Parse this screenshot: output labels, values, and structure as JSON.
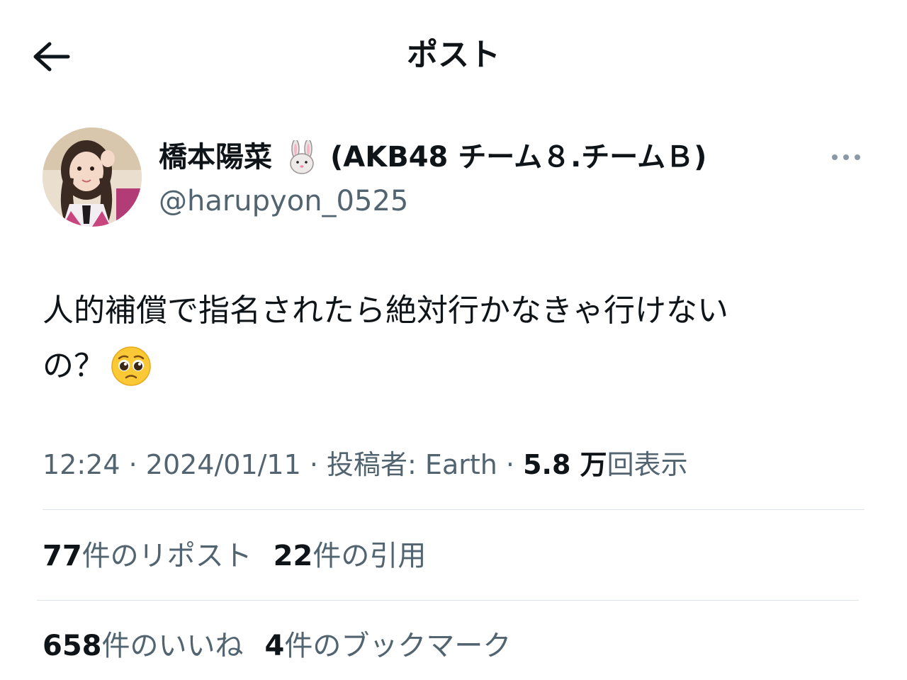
{
  "header": {
    "title": "ポスト",
    "back_icon": "arrow-left-icon"
  },
  "author": {
    "display_name": "橋本陽菜",
    "name_emoji": "rabbit-face-icon",
    "display_suffix": "(AKB48 チーム８.チームＢ)",
    "handle": "@harupyon_0525",
    "more_icon": "more-horizontal-icon"
  },
  "post": {
    "line1": "人的補償で指名されたら絶対行かなきゃ行けない",
    "line2": "の？",
    "trailing_emoji": "pleading-face-icon"
  },
  "meta": {
    "time": "12:24",
    "date": "2024/01/11",
    "posted_by_label": "投稿者: Earth",
    "views_number": "5.8 万",
    "views_label": "回表示",
    "separator": " · "
  },
  "stats": {
    "reposts_count": "77",
    "reposts_label": "件のリポスト",
    "quotes_count": "22",
    "quotes_label": "件の引用",
    "likes_count": "658",
    "likes_label": "件のいいね",
    "bookmarks_count": "4",
    "bookmarks_label": "件のブックマーク"
  },
  "colors": {
    "text_primary": "#0f1419",
    "text_secondary": "#536471",
    "divider": "#dde3e8"
  }
}
